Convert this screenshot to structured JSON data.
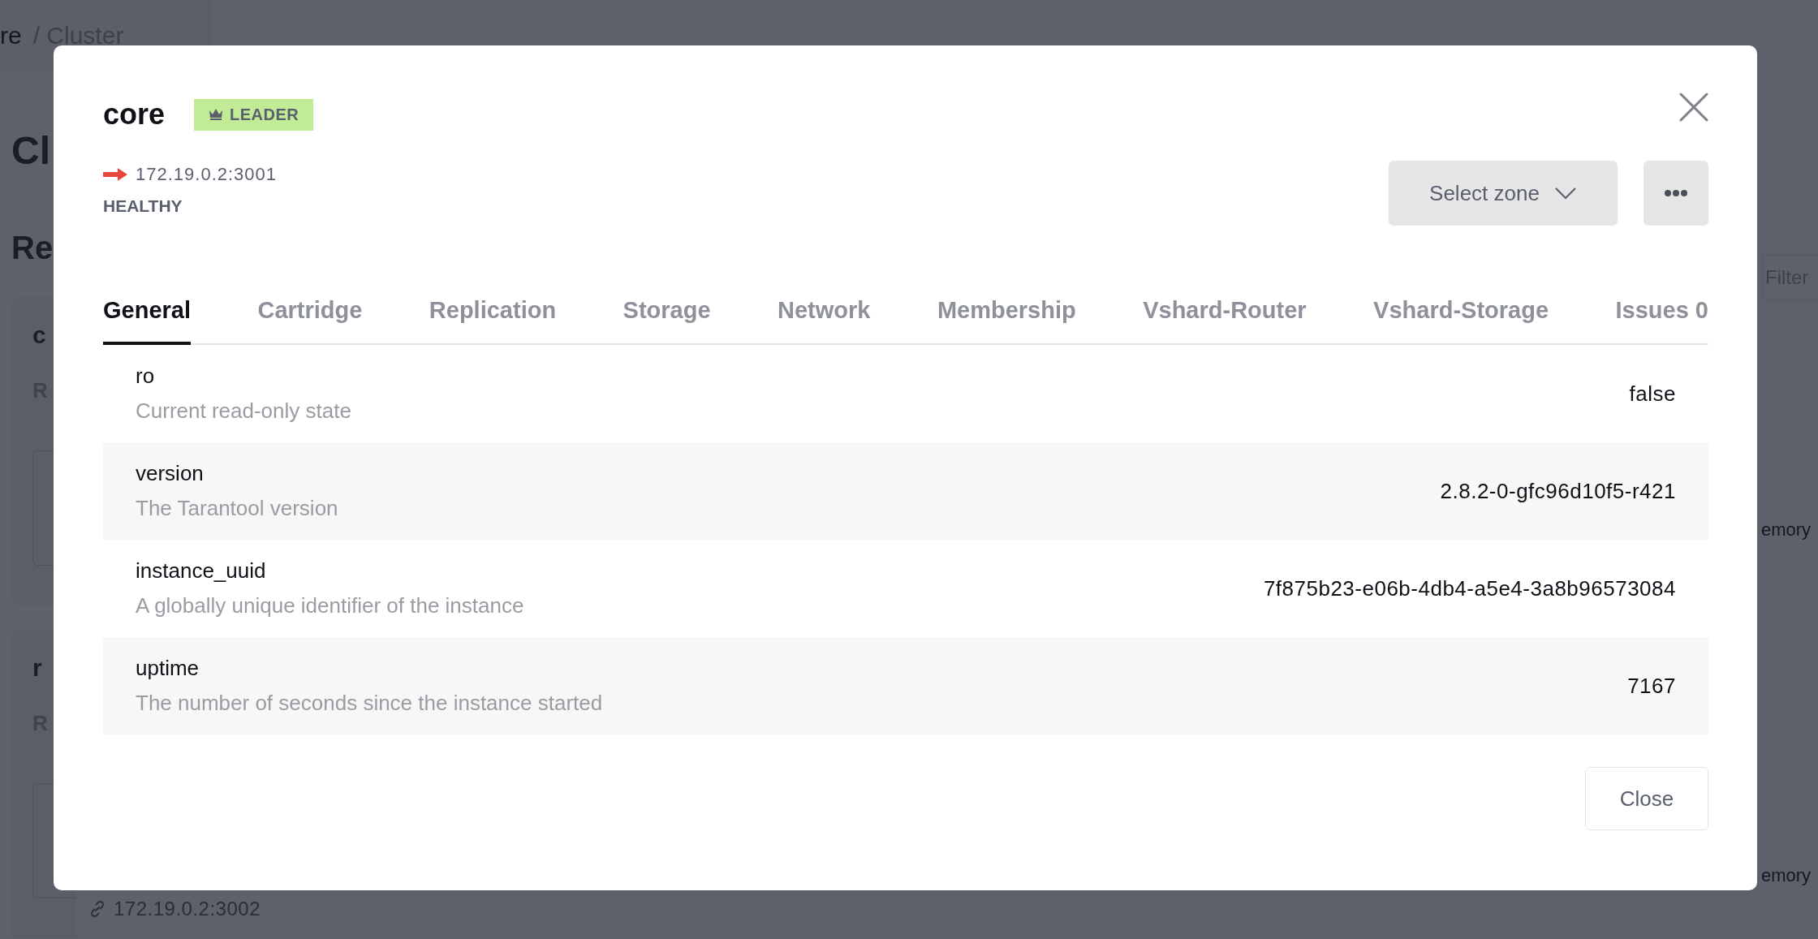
{
  "background": {
    "breadcrumb_current": "re",
    "breadcrumb_rest": "/ Cluster",
    "heading": "Cl",
    "section": "Re",
    "filter_placeholder": "Filter",
    "replicasets": [
      {
        "name": "c",
        "label": "R",
        "memory": "emory"
      },
      {
        "name": "r",
        "label": "R",
        "memory": "emory",
        "address": "172.19.0.2:3002"
      }
    ]
  },
  "modal": {
    "title": "core",
    "badge": "LEADER",
    "address": "172.19.0.2:3001",
    "status": "HEALTHY",
    "zone_button": "Select zone",
    "tabs": [
      {
        "label": "General",
        "selected": true
      },
      {
        "label": "Cartridge",
        "selected": false
      },
      {
        "label": "Replication",
        "selected": false
      },
      {
        "label": "Storage",
        "selected": false
      },
      {
        "label": "Network",
        "selected": false
      },
      {
        "label": "Membership",
        "selected": false
      },
      {
        "label": "Vshard-Router",
        "selected": false
      },
      {
        "label": "Vshard-Storage",
        "selected": false
      },
      {
        "label": "Issues 0",
        "selected": false
      }
    ],
    "rows": [
      {
        "name": "ro",
        "description": "Current read-only state",
        "value": "false"
      },
      {
        "name": "version",
        "description": "The Tarantool version",
        "value": "2.8.2-0-gfc96d10f5-r421"
      },
      {
        "name": "instance_uuid",
        "description": "A globally unique identifier of the instance",
        "value": "7f875b23-e06b-4db4-a5e4-3a8b96573084"
      },
      {
        "name": "uptime",
        "description": "The number of seconds since the instance started",
        "value": "7167"
      }
    ],
    "close_button": "Close"
  }
}
